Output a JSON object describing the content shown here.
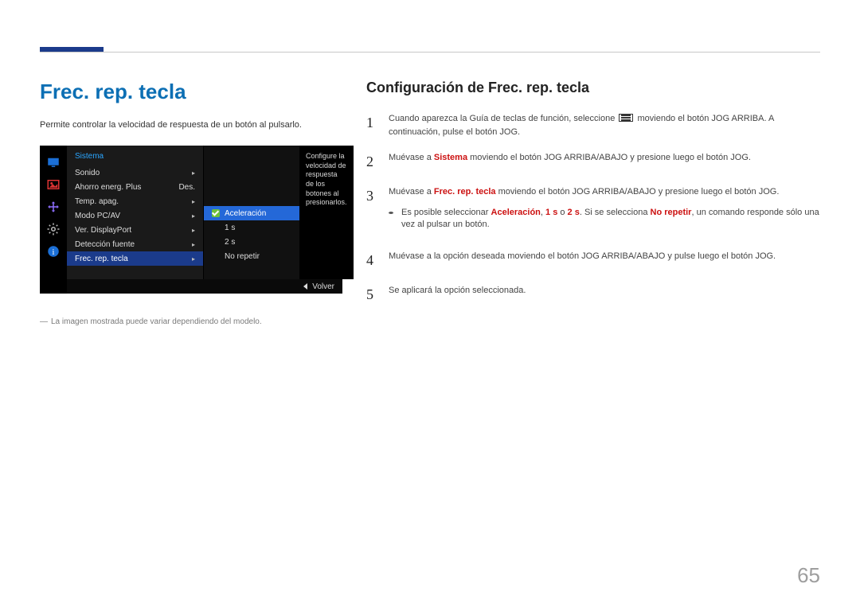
{
  "page_number": "65",
  "left": {
    "title": "Frec. rep. tecla",
    "intro": "Permite controlar la velocidad de respuesta de un botón al pulsarlo.",
    "footnote": "La imagen mostrada puede variar dependiendo del modelo."
  },
  "osd": {
    "header": "Sistema",
    "items": [
      {
        "label": "Sonido",
        "value": "",
        "arrow": true
      },
      {
        "label": "Ahorro energ. Plus",
        "value": "Des.",
        "arrow": false
      },
      {
        "label": "Temp. apag.",
        "value": "",
        "arrow": true
      },
      {
        "label": "Modo PC/AV",
        "value": "",
        "arrow": true
      },
      {
        "label": "Ver. DisplayPort",
        "value": "",
        "arrow": true
      },
      {
        "label": "Detección fuente",
        "value": "",
        "arrow": true
      },
      {
        "label": "Frec. rep. tecla",
        "value": "",
        "arrow": true,
        "selected": true
      }
    ],
    "sub": [
      {
        "label": "Aceleración",
        "selected": true
      },
      {
        "label": "1 s"
      },
      {
        "label": "2 s"
      },
      {
        "label": "No repetir"
      }
    ],
    "description": "Configure la velocidad de respuesta de los botones al presionarlos.",
    "footer": "Volver"
  },
  "right": {
    "title": "Configuración de Frec. rep. tecla",
    "steps": {
      "s1_a": "Cuando aparezca la Guía de teclas de función, seleccione ",
      "s1_b": " moviendo el botón JOG ARRIBA. A continuación, pulse el botón JOG.",
      "s2_a": "Muévase a ",
      "s2_b": "Sistema",
      "s2_c": " moviendo el botón JOG ARRIBA/ABAJO y presione luego el botón JOG.",
      "s3_a": "Muévase a ",
      "s3_b": "Frec. rep. tecla",
      "s3_c": " moviendo el botón JOG ARRIBA/ABAJO y presione luego el botón JOG.",
      "bullet_a": "Es posible seleccionar ",
      "bullet_b": "Aceleración",
      "bullet_c": ", ",
      "bullet_d": "1 s",
      "bullet_e": " o ",
      "bullet_f": "2 s",
      "bullet_g": ". Si se selecciona ",
      "bullet_h": "No repetir",
      "bullet_i": ", un comando responde sólo una vez al pulsar un botón.",
      "s4": "Muévase a la opción deseada moviendo el botón JOG ARRIBA/ABAJO y pulse luego el botón JOG.",
      "s5": "Se aplicará la opción seleccionada."
    },
    "nums": {
      "n1": "1",
      "n2": "2",
      "n3": "3",
      "n4": "4",
      "n5": "5"
    }
  }
}
